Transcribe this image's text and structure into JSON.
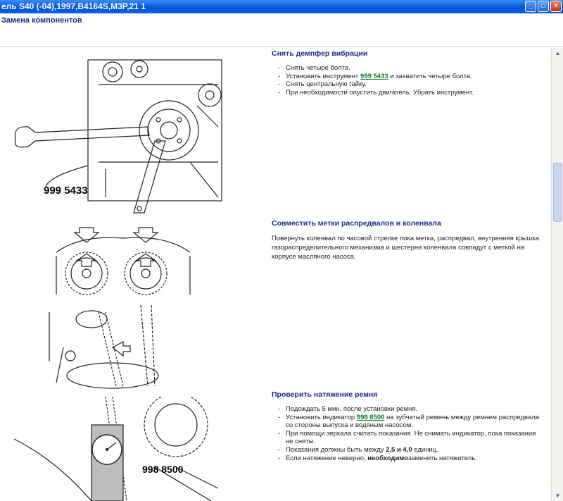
{
  "window": {
    "title": "ель S40 (-04),1997,B4164S,M3P,21 1",
    "buttons": {
      "minimize": "_",
      "maximize": "□",
      "close": "×"
    }
  },
  "header": {
    "title": "Замена компонентов"
  },
  "figures": {
    "fig1_label": "999 5433",
    "fig4_label": "998 8500"
  },
  "sections": {
    "damper": {
      "title": "Снять демпфер вибрации",
      "items": [
        "Снять четыре болта.",
        {
          "pre": "Установить инструмент ",
          "link": "999 5433",
          "post": " и захватить четыре болта."
        },
        "Снять центральную гайку.",
        "При необходимости опустить двигатель. Убрать инструмент."
      ]
    },
    "marks": {
      "title": "Совместить метки распредвалов и коленвала",
      "paragraph": "Повернуть коленвал по часовой стрелке пока метка, распредвал, внутренняя крышка газораспределительного механизма и шестерня коленвала совпадут с меткой на корпусе масляного насоса."
    },
    "tension": {
      "title": "Проверить натяжение ремня",
      "item1": "Подождать 5 мин. после установки ремня.",
      "item2_pre": "Установить индикатор ",
      "item2_link": "998 8500",
      "item2_post": " на зубчатый ремень между ремнем распредвала со стороны выпуска и водяным насосом.",
      "item3": "При помощи зеркала считать показания. Не снимать индикатор, пока показания не сняты.",
      "item4_pre": "Показания должны быть между ",
      "item4_b1": "2,5",
      "item4_mid1": " ",
      "item4_b2": "и 4,0",
      "item4_post": " единиц.",
      "item5_pre": "Если натяжение неверно, ",
      "item5_b": "необходимо",
      "item5_post": "заменить натяжитель."
    }
  },
  "colors": {
    "accent_title": "#1c2a8c",
    "link": "#0a7a28",
    "titlebar": "#0a5fe0"
  }
}
